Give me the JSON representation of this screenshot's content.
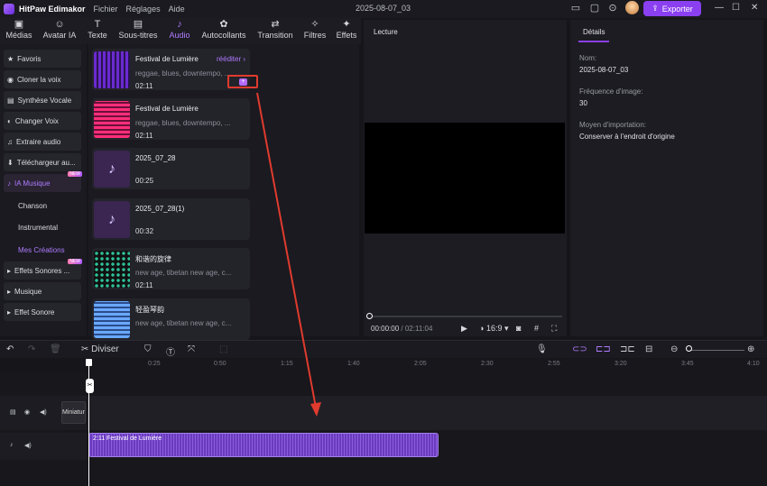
{
  "app": {
    "name": "HitPaw Edimakor",
    "menus": [
      "Fichier",
      "Réglages",
      "Aide"
    ],
    "project_title": "2025-08-07_03",
    "export_label": "Exporter"
  },
  "colors": {
    "accent": "#8a3ff0",
    "accent_text": "#b07cff",
    "annotation_red": "#e03b2e"
  },
  "main_tabs": [
    {
      "label": "Médias",
      "icon": "media-icon"
    },
    {
      "label": "Avatar IA",
      "icon": "avatar-icon"
    },
    {
      "label": "Texte",
      "icon": "text-icon"
    },
    {
      "label": "Sous-titres",
      "icon": "subtitles-icon"
    },
    {
      "label": "Audio",
      "icon": "music-note-icon",
      "active": true
    },
    {
      "label": "Autocollants",
      "icon": "stickers-icon"
    },
    {
      "label": "Transition",
      "icon": "transition-icon"
    },
    {
      "label": "Filtres",
      "icon": "filters-icon"
    },
    {
      "label": "Effets",
      "icon": "effects-icon"
    }
  ],
  "sidebar": {
    "items": [
      {
        "label": "Favoris",
        "icon": "star-icon"
      },
      {
        "label": "Cloner la voix",
        "icon": "voice-clone-icon"
      },
      {
        "label": "Synthèse Vocale",
        "icon": "tts-icon"
      },
      {
        "label": "Changer Voix",
        "icon": "voice-change-icon"
      },
      {
        "label": "Extraire audio",
        "icon": "microphone-icon"
      },
      {
        "label": "Téléchargeur au...",
        "icon": "download-icon"
      },
      {
        "label": "IA Musique",
        "icon": "ai-music-icon",
        "badge": "NEW"
      },
      {
        "label": "Chanson"
      },
      {
        "label": "Instrumental"
      },
      {
        "label": "Mes Créations"
      },
      {
        "label": "Effets Sonores ...",
        "icon": "caret-right-icon",
        "badge": "NEW"
      },
      {
        "label": "Musique",
        "icon": "caret-right-icon"
      },
      {
        "label": "Effet Sonore",
        "icon": "caret-right-icon"
      }
    ]
  },
  "audio_items": [
    {
      "title": "Festival de Lumière",
      "tags": "reggae, blues, downtempo, ...",
      "duration": "02:11",
      "edit_label": "rééditer",
      "add": "+"
    },
    {
      "title": "Festival de Lumière",
      "tags": "reggae, blues, downtempo, ...",
      "duration": "02:11"
    },
    {
      "title": "2025_07_28",
      "tags": "",
      "duration": "00:25"
    },
    {
      "title": "2025_07_28(1)",
      "tags": "",
      "duration": "00:32"
    },
    {
      "title": "和谐的旋律",
      "tags": "new age, tibetan new age, c...",
      "duration": "02:11"
    },
    {
      "title": "轻盈琴韵",
      "tags": "new age, tibetan new age, c...",
      "duration": ""
    }
  ],
  "preview": {
    "label": "Lecture",
    "current_time": "00:00:00",
    "total_time": "02:11:04",
    "ratio": "16:9",
    "progress": 0
  },
  "details": {
    "tab": "Détails",
    "fields": [
      {
        "label": "Nom:",
        "value": "2025-08-07_03"
      },
      {
        "label": "Fréquence d'image:",
        "value": "30"
      },
      {
        "label": "Moyen d'importation:",
        "value": "Conserver à l'endroit d'origine"
      }
    ]
  },
  "toolbar": {
    "split_label": "Diviser"
  },
  "ruler": [
    "0:25",
    "0:50",
    "1:15",
    "1:40",
    "2:05",
    "2:30",
    "2:55",
    "3:20",
    "3:45",
    "4:10"
  ],
  "timeline": {
    "text_clip": "Miniatur",
    "audio_clip": "2:11 Festival de Lumière"
  }
}
